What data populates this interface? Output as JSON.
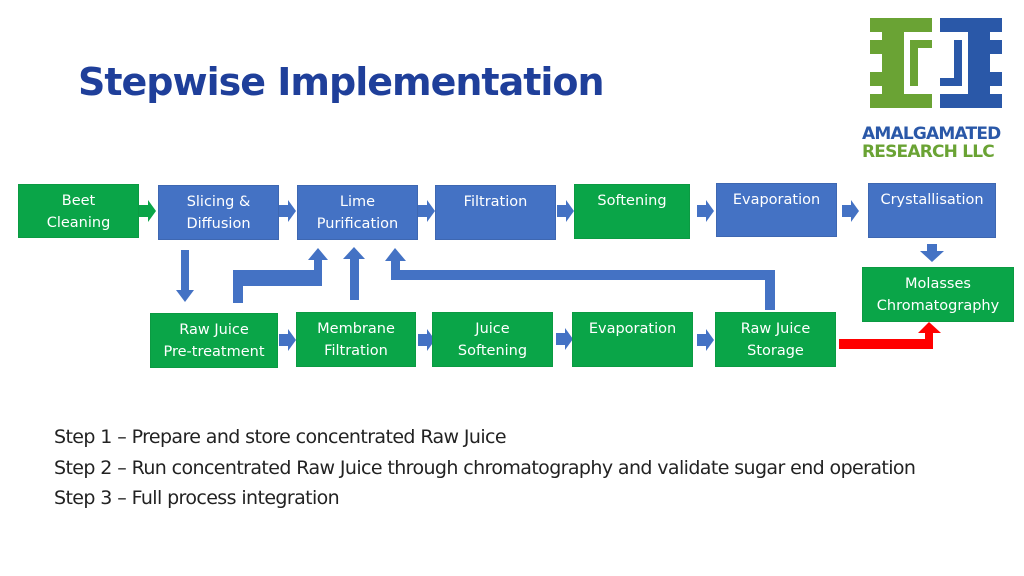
{
  "title": "Stepwise Implementation",
  "logo": {
    "line1": "AMALGAMATED",
    "line2": "RESEARCH LLC",
    "colors": {
      "green": "#6aa334",
      "blue": "#2a58a8"
    }
  },
  "colors": {
    "process_green": "#0aa548",
    "process_blue": "#4472c4",
    "arrow_blue": "#4472c4",
    "highlight_arrow": "#ff0000",
    "title": "#1f3f9a"
  },
  "diagram": {
    "top_row": [
      {
        "id": "beet-cleaning",
        "label": "Beet\nCleaning",
        "color": "green"
      },
      {
        "id": "slicing-diffusion",
        "label": "Slicing &\nDiffusion",
        "color": "blue"
      },
      {
        "id": "lime-purification",
        "label": "Lime\nPurification",
        "color": "blue"
      },
      {
        "id": "filtration",
        "label": "Filtration",
        "color": "blue"
      },
      {
        "id": "softening",
        "label": "Softening",
        "color": "green"
      },
      {
        "id": "evaporation-top",
        "label": "Evaporation",
        "color": "blue"
      },
      {
        "id": "crystallisation",
        "label": "Crystallisation",
        "color": "blue"
      }
    ],
    "side": [
      {
        "id": "molasses-chromatography",
        "label": "Molasses\nChromatography",
        "color": "green"
      }
    ],
    "bottom_row": [
      {
        "id": "raw-juice-pretreatment",
        "label": "Raw Juice\nPre-treatment",
        "color": "green"
      },
      {
        "id": "membrane-filtration",
        "label": "Membrane\nFiltration",
        "color": "green"
      },
      {
        "id": "juice-softening",
        "label": "Juice\nSoftening",
        "color": "green"
      },
      {
        "id": "evaporation-bottom",
        "label": "Evaporation",
        "color": "green"
      },
      {
        "id": "raw-juice-storage",
        "label": "Raw Juice\nStorage",
        "color": "green"
      }
    ],
    "connections": [
      {
        "from": "beet-cleaning",
        "to": "slicing-diffusion",
        "color": "green"
      },
      {
        "from": "slicing-diffusion",
        "to": "lime-purification",
        "color": "blue"
      },
      {
        "from": "lime-purification",
        "to": "filtration",
        "color": "blue"
      },
      {
        "from": "filtration",
        "to": "softening",
        "color": "blue"
      },
      {
        "from": "softening",
        "to": "evaporation-top",
        "color": "blue"
      },
      {
        "from": "evaporation-top",
        "to": "crystallisation",
        "color": "blue"
      },
      {
        "from": "crystallisation",
        "to": "molasses-chromatography",
        "color": "blue"
      },
      {
        "from": "slicing-diffusion",
        "to": "raw-juice-pretreatment",
        "color": "blue"
      },
      {
        "from": "raw-juice-pretreatment",
        "to": "lime-purification",
        "color": "blue"
      },
      {
        "from": "membrane-filtration",
        "to": "lime-purification",
        "color": "blue"
      },
      {
        "from": "raw-juice-storage",
        "to": "lime-purification",
        "color": "blue"
      },
      {
        "from": "raw-juice-pretreatment",
        "to": "membrane-filtration",
        "color": "blue"
      },
      {
        "from": "membrane-filtration",
        "to": "juice-softening",
        "color": "blue"
      },
      {
        "from": "juice-softening",
        "to": "evaporation-bottom",
        "color": "blue"
      },
      {
        "from": "evaporation-bottom",
        "to": "raw-juice-storage",
        "color": "blue"
      },
      {
        "from": "raw-juice-storage",
        "to": "molasses-chromatography",
        "color": "red"
      }
    ]
  },
  "steps": [
    "Step 1 – Prepare and store concentrated Raw Juice",
    "Step 2 – Run concentrated Raw Juice through chromatography and validate sugar end operation",
    "Step 3 – Full process integration"
  ]
}
